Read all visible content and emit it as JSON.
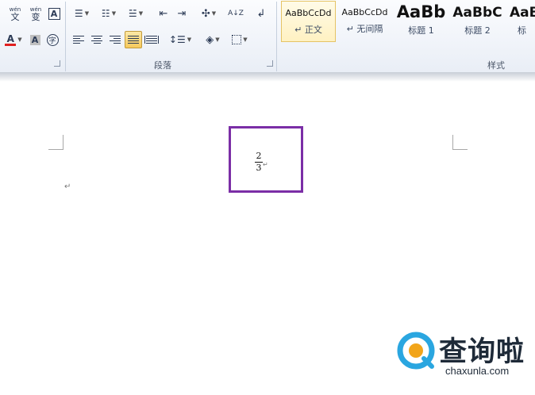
{
  "ribbon": {
    "font_group": {
      "font_color_label": "A",
      "char_shading_label": "A",
      "enclose_char_label": "字",
      "phonetic_label": "文",
      "char_border_label": "A"
    },
    "paragraph_group": {
      "label": "段落",
      "sort_label": "A↓Z"
    },
    "styles_group": {
      "label": "样式",
      "items": [
        {
          "sample": "AaBbCcDd",
          "name": "↵ 正文"
        },
        {
          "sample": "AaBbCcDd",
          "name": "↵ 无间隔"
        },
        {
          "sample": "AaBb",
          "name": "标题 1"
        },
        {
          "sample": "AaBbC",
          "name": "标题 2"
        },
        {
          "sample": "AaB",
          "name": "标"
        }
      ]
    }
  },
  "document": {
    "paragraph_mark": "↵",
    "fraction": {
      "numerator": "2",
      "denominator": "3"
    },
    "fraction_mark": "↵"
  },
  "colors": {
    "highlight_border": "#7b2ea6",
    "font_color_underline": "#e02020"
  },
  "watermark": {
    "brand": "查询啦",
    "url": "chaxunla.com"
  }
}
